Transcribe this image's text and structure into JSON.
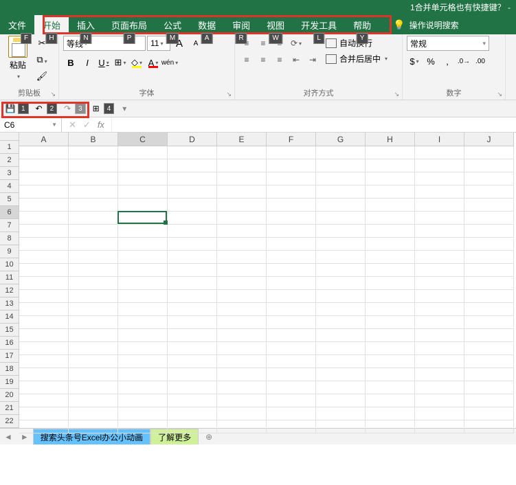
{
  "title": "1合并单元格也有快捷键？ -",
  "menu": {
    "file": "文件",
    "home": "开始",
    "insert": "插入",
    "layout": "页面布局",
    "formulas": "公式",
    "data": "数据",
    "review": "审阅",
    "view": "视图",
    "dev": "开发工具",
    "help": "帮助",
    "tellme": "操作说明搜索"
  },
  "keytips": {
    "file": "F",
    "home": "H",
    "insert": "N",
    "layout": "P",
    "formulas": "M",
    "data": "A",
    "review": "R",
    "view": "W",
    "dev": "L",
    "help": "Y"
  },
  "ribbon": {
    "clipboard": {
      "paste": "粘贴",
      "label": "剪贴板"
    },
    "font": {
      "name": "等线",
      "size": "11",
      "grow": "A",
      "shrink": "A",
      "bold": "B",
      "italic": "I",
      "underline": "U",
      "label": "字体"
    },
    "align": {
      "wrap": "自动换行",
      "merge": "合并后居中",
      "label": "对齐方式"
    },
    "number": {
      "format": "常规",
      "label": "数字"
    }
  },
  "qat_nums": [
    "1",
    "2",
    "3",
    "4"
  ],
  "namebox": "C6",
  "columns": [
    "A",
    "B",
    "C",
    "D",
    "E",
    "F",
    "G",
    "H",
    "I",
    "J"
  ],
  "rows": [
    "1",
    "2",
    "3",
    "4",
    "5",
    "6",
    "7",
    "8",
    "9",
    "10",
    "11",
    "12",
    "13",
    "14",
    "15",
    "16",
    "17",
    "18",
    "19",
    "20",
    "21",
    "22"
  ],
  "selected": {
    "row": 6,
    "col": 3
  },
  "tabs": {
    "tab1": "搜索头条号Excel办公小动画",
    "tab2": "了解更多"
  }
}
